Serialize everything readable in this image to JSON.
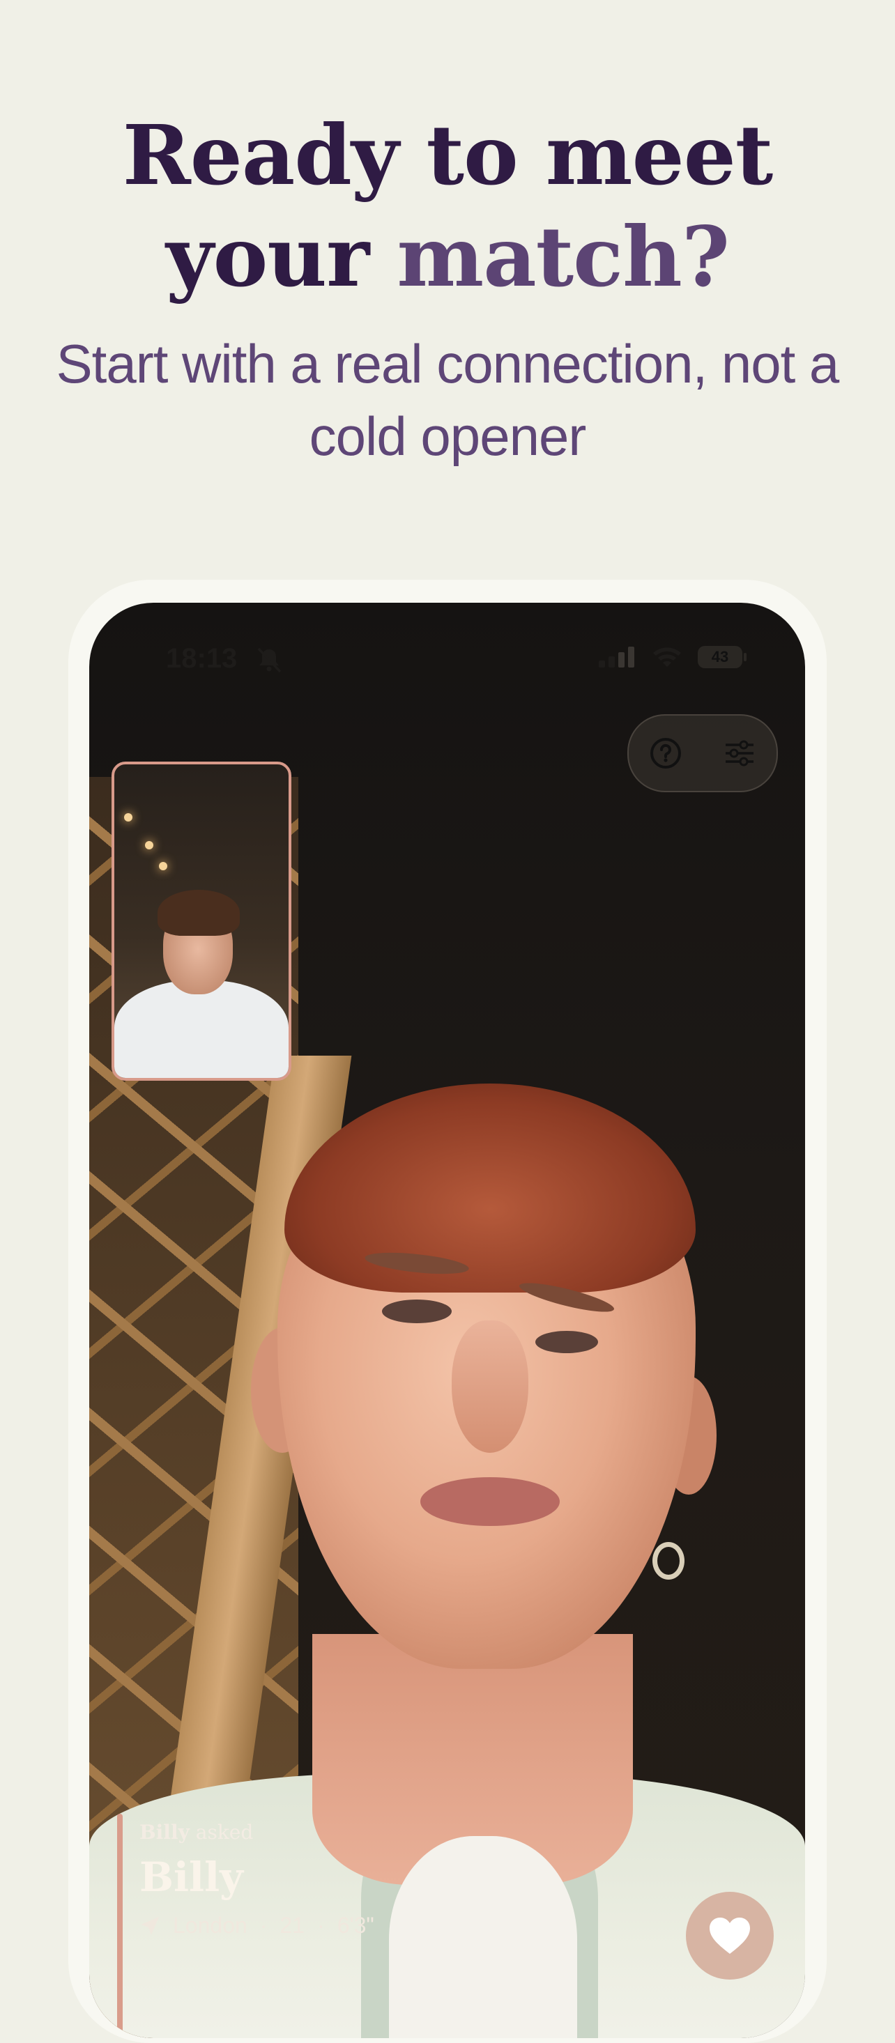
{
  "hero": {
    "title_line1": "Ready to meet",
    "title_line2_plain": "your",
    "title_line2_accent": "match?",
    "subtitle": "Start with a real connection, not a cold opener"
  },
  "status_bar": {
    "time": "18:13",
    "battery": "43"
  },
  "controls": {
    "help_icon": "question-circle-icon",
    "filters_icon": "sliders-icon"
  },
  "match": {
    "asked_name": "Billy",
    "asked_suffix": "asked",
    "name": "Billy",
    "location": "London",
    "age": "21",
    "height": "6'3\""
  },
  "colors": {
    "background": "#f0f0e7",
    "title": "#2f1b44",
    "accent": "#5c4474",
    "heart_button": "#d7b4a3",
    "pip_border": "#d89a8a"
  }
}
